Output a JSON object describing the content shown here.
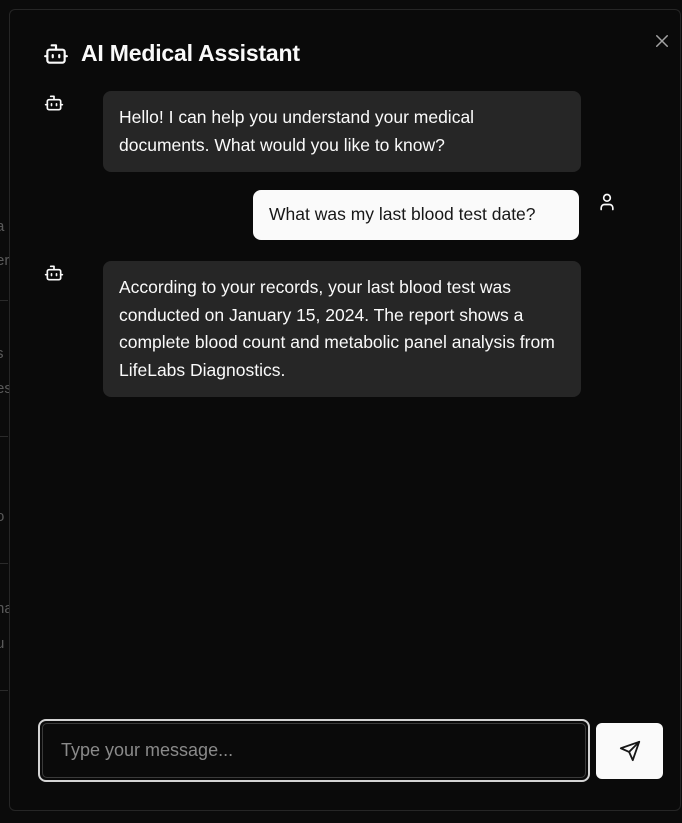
{
  "dialog": {
    "title": "AI Medical Assistant",
    "title_icon": "bot-icon",
    "close_icon": "close-icon"
  },
  "messages": [
    {
      "role": "assistant",
      "icon": "bot-icon",
      "text": "Hello! I can help you understand your medical documents. What would you like to know?"
    },
    {
      "role": "user",
      "icon": "user-icon",
      "text": "What was my last blood test date?"
    },
    {
      "role": "assistant",
      "icon": "bot-icon",
      "text": "According to your records, your last blood test was conducted on January 15, 2024. The report shows a complete blood count and metabolic panel analysis from LifeLabs Diagnostics."
    }
  ],
  "composer": {
    "placeholder": "Type your message...",
    "value": "",
    "send_icon": "send-icon"
  },
  "background_fragments": [
    "a",
    "er",
    "s",
    "es",
    "o",
    "na",
    "u"
  ],
  "colors": {
    "background": "#0a0a0a",
    "assistant_bubble": "#262626",
    "user_bubble": "#fafafa",
    "border": "#262626"
  }
}
